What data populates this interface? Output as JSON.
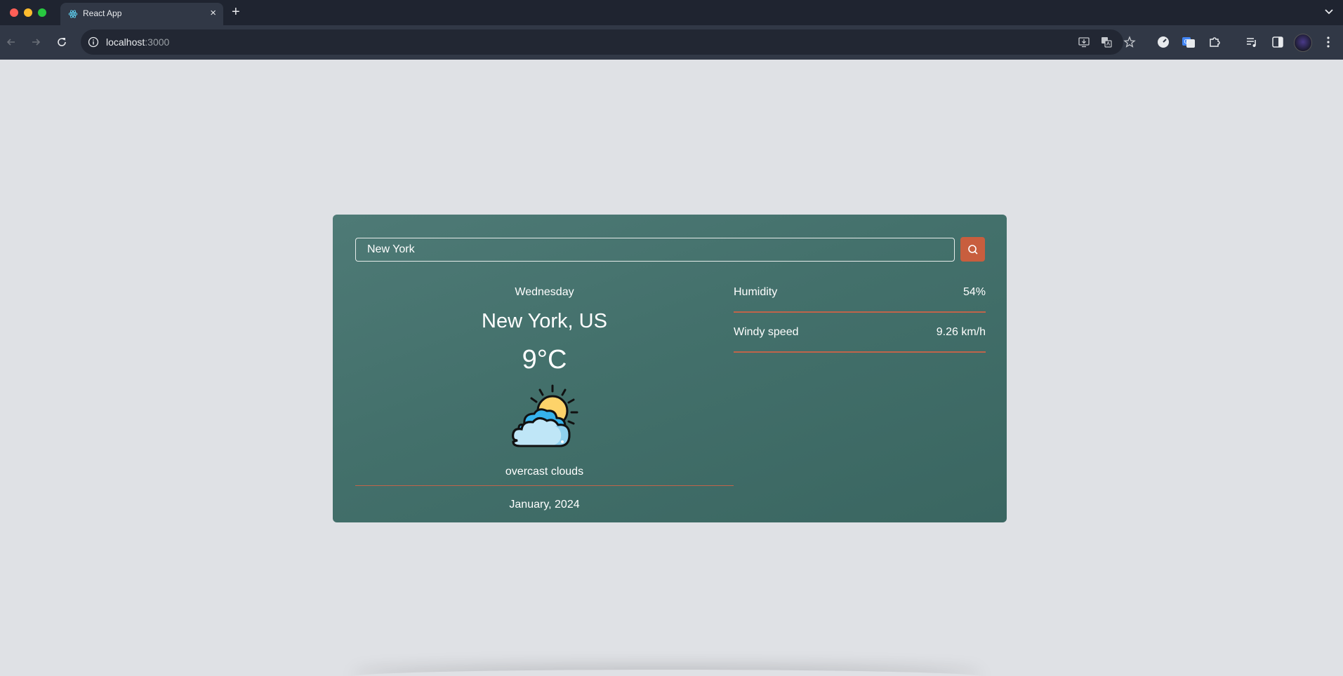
{
  "browser": {
    "tab_title": "React App",
    "url_host": "localhost",
    "url_port": ":3000",
    "icons": [
      "back-icon",
      "forward-icon",
      "reload-icon",
      "site-info-icon",
      "install-app-icon",
      "translate-icon",
      "bookmark-star-icon",
      "extension-icons",
      "reading-list-icon",
      "side-panel-icon",
      "profile-avatar"
    ]
  },
  "app": {
    "search": {
      "value": "New York"
    },
    "weather": {
      "day": "Wednesday",
      "location": "New York, US",
      "temperature": "9°C",
      "description": "overcast clouds",
      "date": "January, 2024",
      "icon": "sun-behind-clouds-icon"
    },
    "stats": [
      {
        "label": "Humidity",
        "value": "54%"
      },
      {
        "label": "Windy speed",
        "value": "9.26 km/h"
      }
    ],
    "colors": {
      "card": "#46716c",
      "accent": "#c85e3e",
      "divider": "#c0644a",
      "page_bg": "#dfe1e5"
    }
  }
}
